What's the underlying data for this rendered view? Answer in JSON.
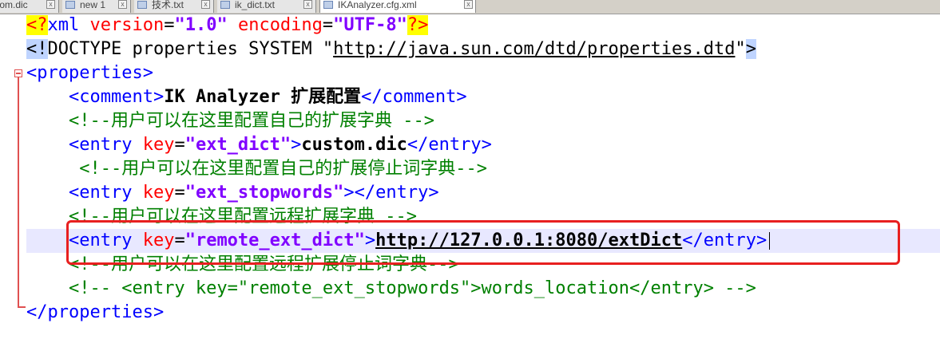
{
  "tabs": [
    {
      "label": "tom.dic",
      "active": false
    },
    {
      "label": "new 1",
      "active": false
    },
    {
      "label": "技术.txt",
      "active": false
    },
    {
      "label": "ik_dict.txt",
      "active": false
    },
    {
      "label": "IKAnalyzer.cfg.xml",
      "active": true
    }
  ],
  "code": {
    "l1": {
      "pi_open": "<?",
      "xml": "xml",
      "version_attr": "version",
      "version_val": "\"1.0\"",
      "encoding_attr": "encoding",
      "encoding_val": "\"UTF-8\"",
      "pi_close": "?>"
    },
    "l2": {
      "open": "<!",
      "text_a": "DOCTYPE properties SYSTEM \"",
      "url": "http://java.sun.com/dtd/properties.dtd",
      "text_b": "\"",
      "close": ">"
    },
    "l3": {
      "tag": "<properties>"
    },
    "l4": {
      "open": "<comment>",
      "text": "IK Analyzer 扩展配置",
      "close": "</comment>"
    },
    "l5": {
      "comment": "<!--用户可以在这里配置自己的扩展字典 -->"
    },
    "l6": {
      "open": "<entry ",
      "attr": "key",
      "eq": "=",
      "val": "\"ext_dict\"",
      "gt": ">",
      "text": "custom.dic",
      "close": "</entry>"
    },
    "l7": {
      "comment": "<!--用户可以在这里配置自己的扩展停止词字典-->"
    },
    "l8": {
      "open": "<entry ",
      "attr": "key",
      "eq": "=",
      "val": "\"ext_stopwords\"",
      "gt": ">",
      "close": "</entry>"
    },
    "l9": {
      "comment": "<!--用户可以在这里配置远程扩展字典 -->"
    },
    "l10": {
      "open": "<entry ",
      "attr": "key",
      "eq": "=",
      "val": "\"remote_ext_dict\"",
      "gt": ">",
      "text": "http://127.0.0.1:8080/extDict",
      "close": "</entry>"
    },
    "l11": {
      "comment": "<!--用户可以在这里配置远程扩展停止词字典-->"
    },
    "l12": {
      "comment": "<!-- <entry key=\"remote_ext_stopwords\">words_location</entry> -->"
    },
    "l13": {
      "tag": "</properties>"
    }
  },
  "colors": {
    "tag": "#0000ff",
    "attr_name": "#ff0000",
    "attr_value": "#8000ff",
    "comment": "#008000",
    "current_line": "#e8e8ff",
    "highlight_box": "#e82020"
  },
  "icons": {
    "tab_file": "document-icon",
    "tab_close": "close-icon",
    "fold": "fold-collapse-icon"
  }
}
